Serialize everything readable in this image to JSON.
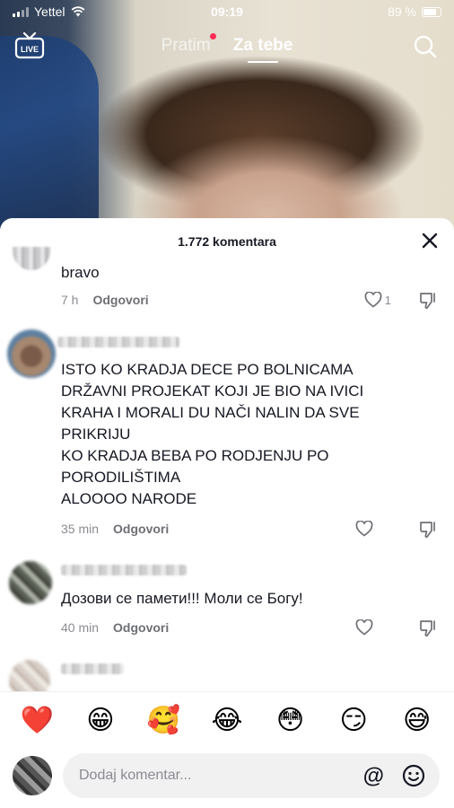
{
  "status_bar": {
    "carrier": "Yettel",
    "time": "09:19",
    "battery": "89 %"
  },
  "top_nav": {
    "live_label": "LIVE",
    "tab_following": "Pratim",
    "tab_foryou": "Za tebe"
  },
  "comments_sheet": {
    "title": "1.772 komentara",
    "comments": [
      {
        "text": "bravo",
        "time": "7 h",
        "reply": "Odgovori",
        "likes": "1"
      },
      {
        "text": "ISTO KO KRADJA DECE PO BOLNICAMA\nDRŽAVNI PROJEKAT KOJI JE BIO NA IVICI KRAHA I MORALI DU NAČI NALIN DA SVE PRIKRIJU\nKO KRADJA BEBA PO RODJENJU PO PORODILIŠTIMA\nALOOOO NARODE",
        "time": "35 min",
        "reply": "Odgovori",
        "likes": ""
      },
      {
        "text": "Дозови се памети!!! Моли се Богу!",
        "time": "40 min",
        "reply": "Odgovori",
        "likes": ""
      }
    ]
  },
  "emoji_bar": [
    "❤️",
    "😁",
    "🥰",
    "😂",
    "😳",
    "😏",
    "😅"
  ],
  "comment_input": {
    "placeholder": "Dodaj komentar...",
    "mention": "@"
  },
  "colors": {
    "accent": "#fe2c55",
    "text": "#161823",
    "muted": "#8a8b91"
  }
}
